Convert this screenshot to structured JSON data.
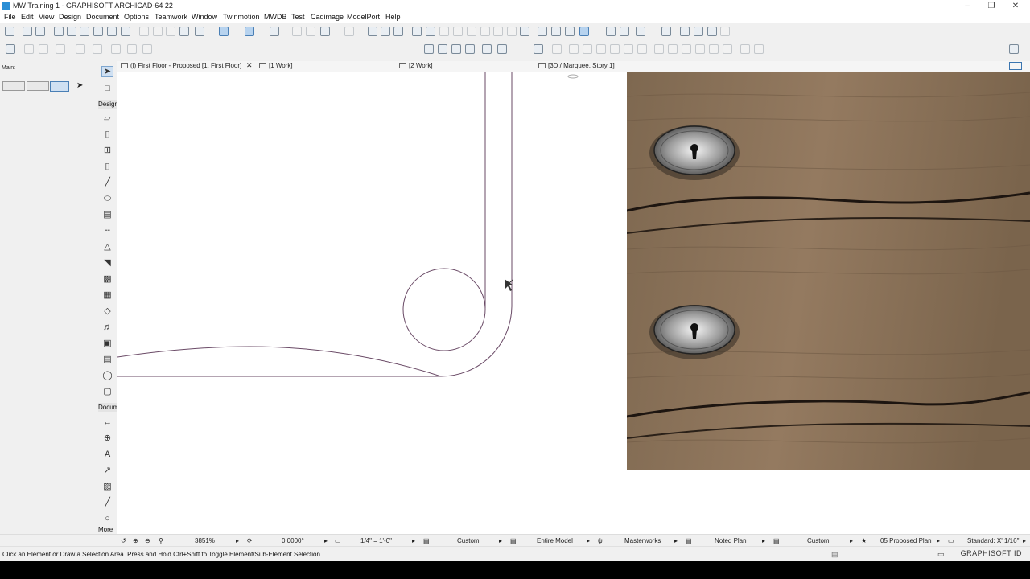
{
  "window": {
    "title": "MW Training 1 - GRAPHISOFT ARCHICAD-64 22"
  },
  "menu": [
    "File",
    "Edit",
    "View",
    "Design",
    "Document",
    "Options",
    "Teamwork",
    "Window",
    "Twinmotion",
    "MWDB",
    "Test",
    "Cadimage",
    "ModelPort",
    "Help"
  ],
  "tabs": [
    {
      "label": "(l) First Floor - Proposed [1. First Floor]"
    },
    {
      "label": "[1 Work]"
    },
    {
      "label": "[2 Work]"
    },
    {
      "label": "[3D / Marquee, Story 1]"
    }
  ],
  "left_panel": {
    "label": "Main:"
  },
  "toolbox": {
    "design_label": "Design",
    "document_label": "Docum",
    "more_label": "More"
  },
  "status": {
    "zoom": "3851%",
    "angle": "0.0000°",
    "scale": "1/4\"  =  1'-0\"",
    "layer_combo": "Custom",
    "model_view": "Entire Model",
    "pen_set": "Masterworks",
    "graphic_override": "Noted Plan",
    "renovation": "Custom",
    "filter": "05 Proposed Plan",
    "dimension": "Standard: X' 1/16\""
  },
  "message": "Click an Element or Draw a Selection Area. Press and Hold Ctrl+Shift to Toggle Element/Sub-Element Selection.",
  "brand": "GRAPHISOFT ID",
  "colors": {
    "wood": "#8a7258",
    "wood_dark": "#5a4632",
    "line": "#6a4a66",
    "accent": "#2b8fd6"
  }
}
